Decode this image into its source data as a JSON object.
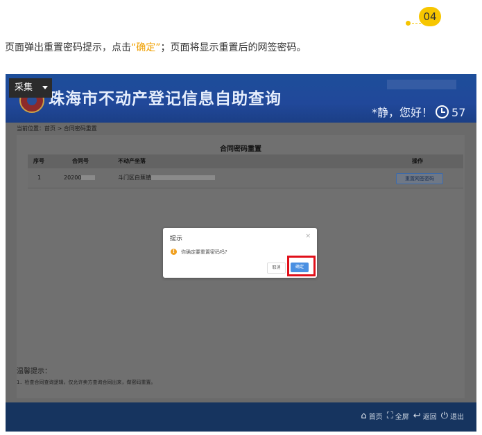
{
  "step": {
    "number": "04"
  },
  "instruction": {
    "before": "页面弹出重置密码提示，点击",
    "highlight": "“确定”",
    "after": "；页面将显示重置后的网签密码。"
  },
  "header": {
    "collect_label": "采集",
    "title": "珠海市不动产登记信息自助查询",
    "greeting": "*静，您好！",
    "countdown": "57"
  },
  "breadcrumb": "当前位置：首页 > 合同密码重置",
  "panel": {
    "title": "合同密码重置",
    "columns": {
      "index": "序号",
      "contract_no": "合同号",
      "property": "不动产坐落",
      "action": "操作"
    },
    "rows": [
      {
        "index": "1",
        "contract_no": "20200",
        "property": "斗门区白蕉镇",
        "action": "重置网签密码"
      }
    ]
  },
  "tips": {
    "title": "温馨提示：",
    "note": "1．检查合同查询逻辑，仅允许卖方查询合同出来，做密码重置。"
  },
  "footer": {
    "home": "首页",
    "fullscreen": "全屏",
    "back": "返回",
    "exit": "退出"
  },
  "dialog": {
    "title": "提示",
    "close": "×",
    "message": "你确定要重置密码吗?",
    "cancel": "取消",
    "confirm": "确定"
  },
  "colors": {
    "highlight_text": "#f0a000",
    "badge": "#f7c600",
    "callout_border": "#e0101a",
    "confirm_button": "#4a90e2"
  }
}
